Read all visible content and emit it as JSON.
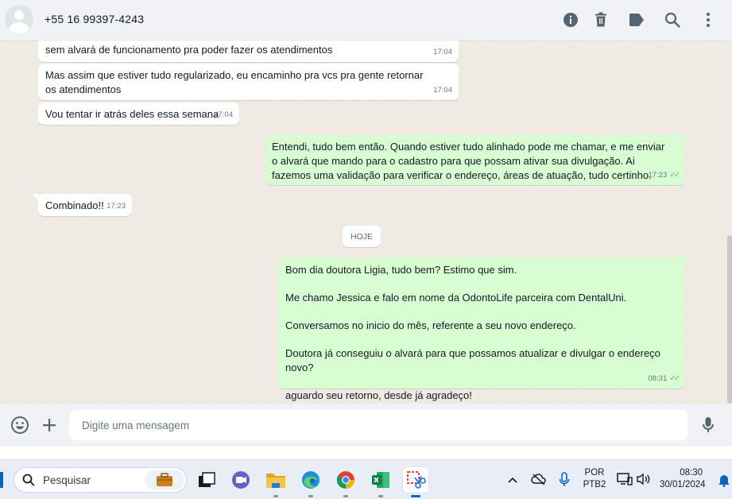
{
  "header": {
    "contact_name": "+55 16 99397-4243",
    "icons": [
      "info-icon",
      "trash-icon",
      "label-icon",
      "search-icon",
      "more-vertical-icon"
    ]
  },
  "chat": {
    "messages": [
      {
        "direction": "in",
        "text": "sem alvará de funcionamento pra poder fazer os atendimentos",
        "time": "17:04"
      },
      {
        "direction": "in",
        "text": "Mas assim que estiver tudo regularizado, eu encaminho pra vcs pra gente retornar os atendimentos",
        "time": "17:04"
      },
      {
        "direction": "in",
        "text": "Vou tentar ir atrás deles essa semana",
        "time": "17:04"
      },
      {
        "direction": "out",
        "text": "Entendi, tudo bem então. Quando estiver tudo alinhado pode me chamar, e me enviar o alvará que mando para o cadastro para que possam ativar sua divulgação. Ai fazemos uma validação para verificar o endereço, áreas de atuação, tudo certinho.",
        "time": "17:23",
        "ticks": "✓✓"
      },
      {
        "direction": "in",
        "text": "Combinado!!",
        "time": "17:23"
      },
      {
        "direction": "out",
        "paragraphs": [
          "Bom dia doutora Ligia, tudo bem? Estimo que sim.",
          "Me chamo Jessica e falo em nome da OdontoLife parceira com DentalUni.",
          "Conversamos no inicio do mês, referente a seu novo endereço.",
          "Doutora já conseguiu o alvará para que possamos atualizar e divulgar o endereço novo?",
          "aguardo seu retorno, desde já agradeço!"
        ],
        "time": "08:31",
        "ticks": "✓✓"
      }
    ],
    "date_divider": "HOJE"
  },
  "composer": {
    "placeholder": "Digite uma mensagem",
    "icons": [
      "emoji-icon",
      "plus-icon",
      "microphone-icon"
    ]
  },
  "taskbar": {
    "search_label": "Pesquisar",
    "apps": [
      "work-briefcase-icon",
      "task-view-icon",
      "teams-icon",
      "file-explorer-icon",
      "edge-icon",
      "chrome-icon",
      "excel-icon",
      "snipping-tool-icon"
    ],
    "language": "POR",
    "keyboard": "PTB2",
    "time": "08:30",
    "date": "30/01/2024"
  }
}
